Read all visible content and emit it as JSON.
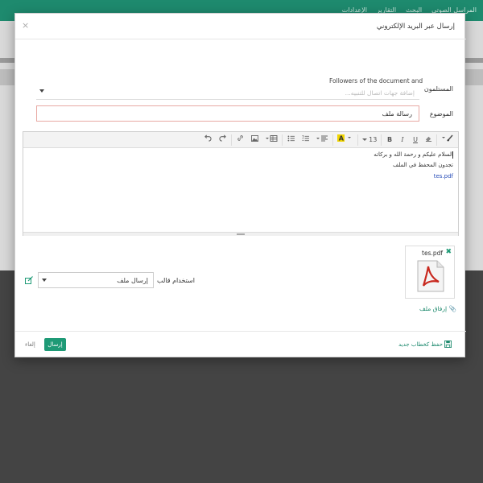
{
  "app": {
    "nav": [
      "المراسل الصوتي",
      "البحث",
      "التقارير",
      "الإعدادات"
    ]
  },
  "modal": {
    "title": "إرسال عبر البريد الإلكتروني",
    "close_glyph": "×"
  },
  "recipients": {
    "label": "المستلمون",
    "followers_text": "Followers of the document and",
    "placeholder": "إضافة جهات اتصال للتنبيه..."
  },
  "subject": {
    "label": "الموضوع",
    "value": "رسالة ملف"
  },
  "editor": {
    "toolbar": [
      "undo-icon",
      "redo-icon",
      "link-icon",
      "image-icon",
      "table-icon",
      "unordered-list-icon",
      "ordered-list-icon",
      "paragraph-icon",
      "font-color-icon",
      "font-size-icon",
      "bold-icon",
      "italic-icon",
      "underline-icon",
      "eraser-icon",
      "style-icon"
    ],
    "font_size": "13",
    "lines": [
      "السلام عليكم و رحمة الله و بركاته",
      "تجدون المحفظ في الملف",
      "tes.pdf"
    ]
  },
  "attachment": {
    "filename": "tes.pdf",
    "attach_link": "إرفاق ملف"
  },
  "template": {
    "label": "استخدام قالب",
    "selected": "إرسال ملف"
  },
  "footer": {
    "send_label": "إرسال",
    "cancel_label": "إلغاء",
    "save_draft_label": "حفظ كخطاب جديد"
  },
  "colors": {
    "primary": "#1e9a76",
    "header": "#1e8a6e",
    "subject_border": "#e8a9a4",
    "pdf_red": "#c8281e"
  }
}
